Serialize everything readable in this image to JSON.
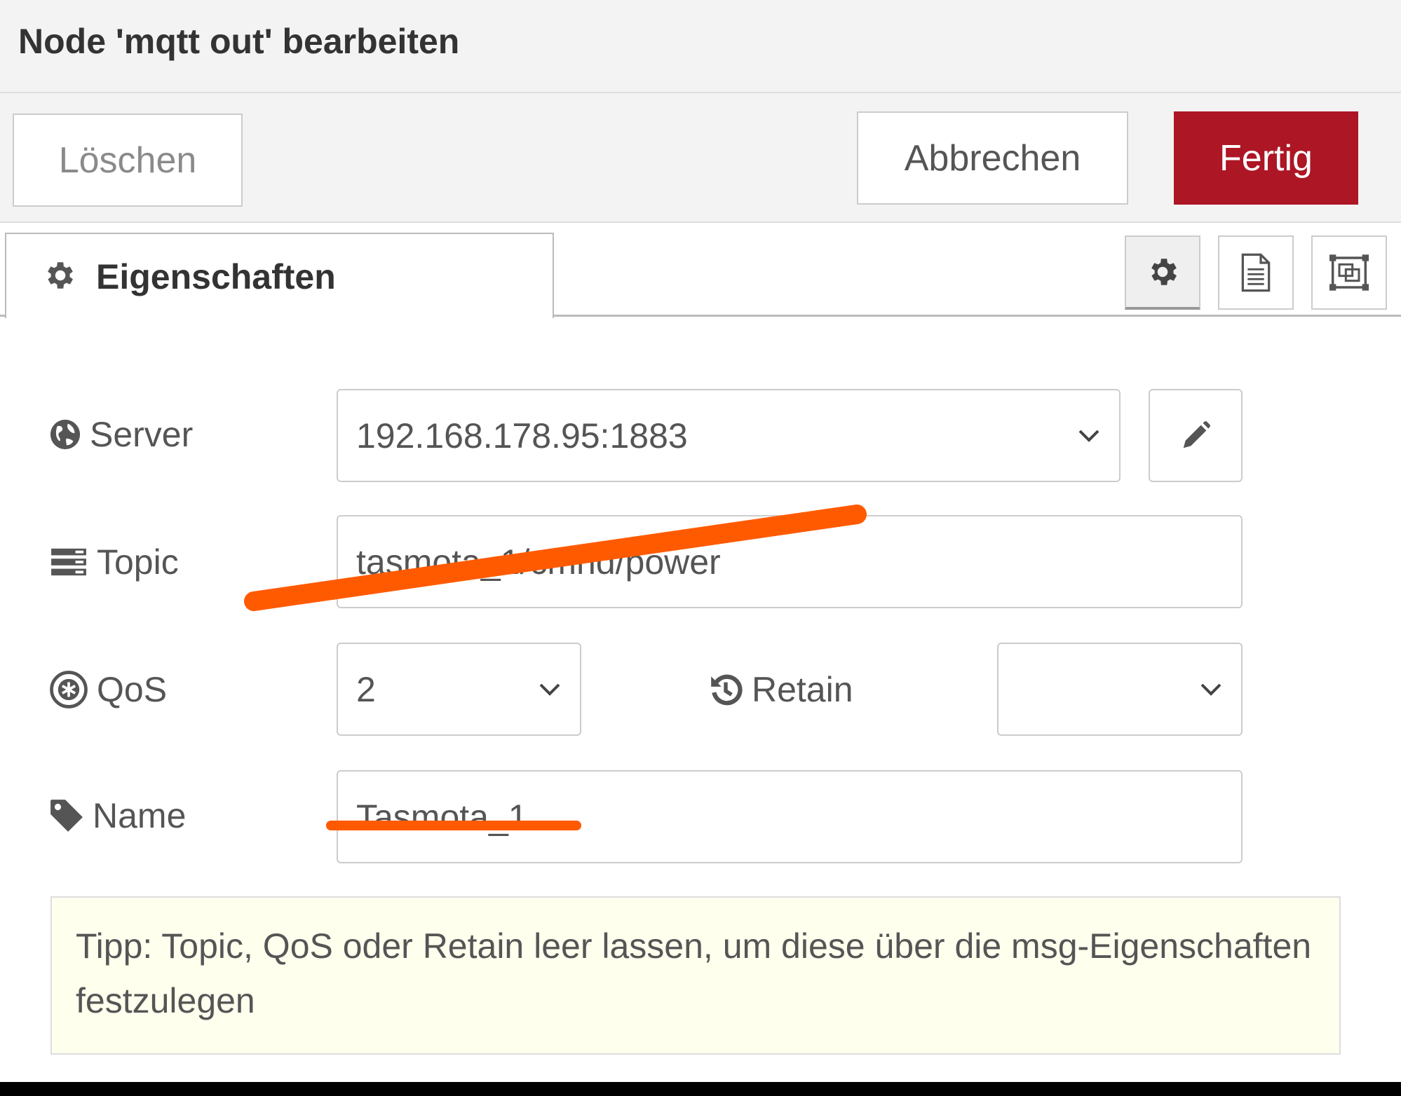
{
  "dialog": {
    "title": "Node 'mqtt out' bearbeiten"
  },
  "tray": {
    "delete_label": "Löschen",
    "cancel_label": "Abbrechen",
    "done_label": "Fertig"
  },
  "tabs": {
    "properties_label": "Eigenschaften"
  },
  "form": {
    "server": {
      "label": "Server",
      "value": "192.168.178.95:1883"
    },
    "topic": {
      "label": "Topic",
      "value": "tasmota_1/cmnd/power"
    },
    "qos": {
      "label": "QoS",
      "value": "2"
    },
    "retain": {
      "label": "Retain",
      "value": ""
    },
    "name": {
      "label": "Name",
      "value": "Tasmota_1"
    }
  },
  "tip": {
    "text": "Tipp: Topic, QoS oder Retain leer lassen, um diese über die msg-Eigenschaften festzulegen"
  },
  "colors": {
    "primary_button": "#ad1625",
    "tip_background": "#ffffee",
    "redaction_marker": "#ff5a00"
  },
  "icons": {
    "tab": "gear-icon",
    "server": "globe-icon",
    "topic": "tasks-icon",
    "qos": "qos-icon",
    "retain": "history-icon",
    "name": "tag-icon",
    "edit": "pencil-icon",
    "description": "file-text-icon",
    "appearance": "object-group-icon"
  }
}
